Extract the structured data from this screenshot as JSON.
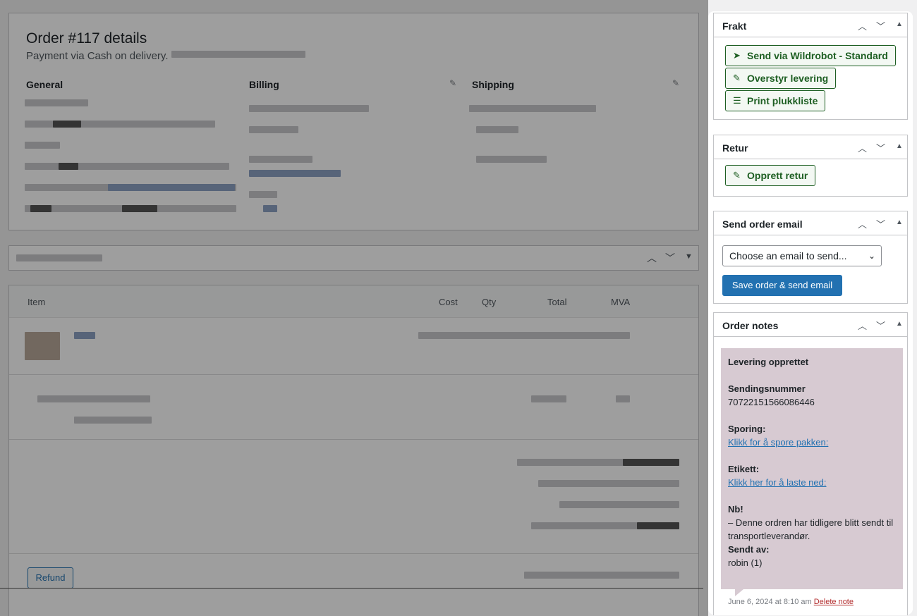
{
  "order": {
    "title": "Order #117 details",
    "payment": "Payment via Cash on delivery.",
    "general": "General",
    "billing": "Billing",
    "shipping": "Shipping"
  },
  "items": {
    "col_item": "Item",
    "col_cost": "Cost",
    "col_qty": "Qty",
    "col_total": "Total",
    "col_mva": "MVA",
    "refund": "Refund"
  },
  "frakt": {
    "title": "Frakt",
    "send": "Send via Wildrobot - Standard",
    "override": "Overstyr levering",
    "print": "Print plukkliste"
  },
  "retur": {
    "title": "Retur",
    "create": "Opprett retur"
  },
  "email": {
    "title": "Send order email",
    "select": "Choose an email to send...",
    "save": "Save order & send email"
  },
  "notes": {
    "title": "Order notes",
    "heading": "Levering opprettet",
    "label_number": "Sendingsnummer",
    "number": "70722151566086446",
    "label_tracking": "Sporing:",
    "tracking_link": "Klikk for å spore pakken:",
    "label_label": "Etikett:",
    "label_link": "Klikk her for å laste ned:",
    "nb": "Nb!",
    "nb_text": "– Denne ordren har tidligere blitt sendt til transportleverandør.",
    "sent_by_label": "Sendt av:",
    "sent_by": "robin (1)",
    "date": "June 6, 2024 at 8:10 am",
    "delete": "Delete note"
  }
}
